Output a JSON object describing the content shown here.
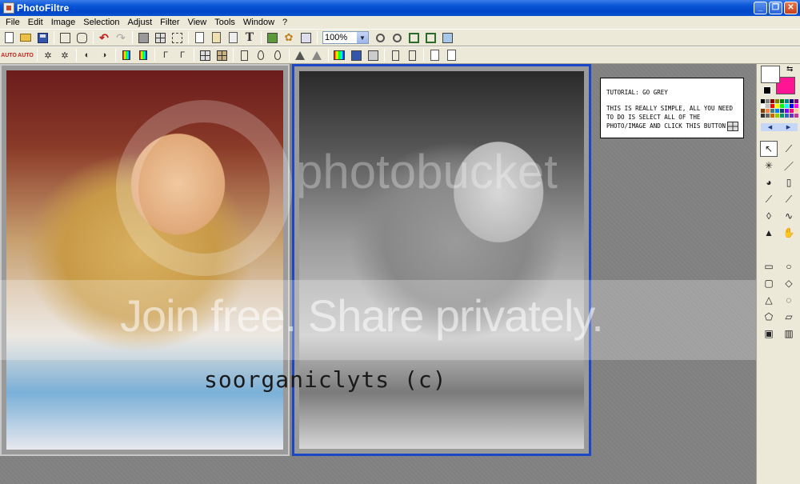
{
  "window": {
    "title": "PhotoFiltre",
    "controls": [
      "minimize",
      "restore",
      "close"
    ]
  },
  "menu": [
    "File",
    "Edit",
    "Image",
    "Selection",
    "Adjust",
    "Filter",
    "View",
    "Tools",
    "Window",
    "?"
  ],
  "toolbar1": {
    "zoom_value": "100%",
    "icons": [
      "new-icon",
      "open-icon",
      "save-icon",
      "print-icon",
      "scan-icon",
      "undo-icon",
      "redo-icon",
      "fill-icon",
      "select-all-icon",
      "crop-icon",
      "copy-icon",
      "paste-icon",
      "paste-new-icon",
      "text-icon",
      "plugin-icon",
      "settings-icon",
      "browser-icon"
    ],
    "zoom_icons": [
      "zoom-in-icon",
      "zoom-out-icon",
      "fit-icon",
      "actual-size-icon",
      "fullscreen-icon"
    ]
  },
  "toolbar2": {
    "auto_label_1": "AUTO",
    "auto_label_2": "AUTO",
    "icons": [
      "auto-levels-icon",
      "auto-contrast-icon",
      "brightness-minus-icon",
      "brightness-plus-icon",
      "contrast-minus-icon",
      "contrast-plus-icon",
      "saturation-minus-icon",
      "saturation-plus-icon",
      "gamma-minus-icon",
      "gamma-plus-icon",
      "grayscale-icon",
      "sepia-icon",
      "flip-icon",
      "blur-icon",
      "sharpen-icon",
      "sharpen-more-icon",
      "smooth-icon",
      "color-icon",
      "swap-icon",
      "frame-icon",
      "rotate-icon",
      "mirror-icon",
      "layer-icon",
      "effect-icon"
    ]
  },
  "note": {
    "heading": "TUTORIAL: GO GREY",
    "body": "THIS IS REALLY SIMPLE, ALL YOU NEED TO DO IS SELECT ALL OF THE PHOTO/IMAGE AND CLICK THIS BUTTON"
  },
  "watermark": {
    "text": "Join free. Share privately.",
    "brand": "photobucket"
  },
  "signature": "soorganiclyts (c)",
  "palette": {
    "foreground": "#ffffff",
    "background": "#ff1493",
    "swatches": [
      "#000000",
      "#808080",
      "#800000",
      "#808000",
      "#008000",
      "#008080",
      "#000080",
      "#800080",
      "#ffffff",
      "#c0c0c0",
      "#ff0000",
      "#ffff00",
      "#00ff00",
      "#00ffff",
      "#0000ff",
      "#ff00ff",
      "#804000",
      "#ff8040",
      "#408080",
      "#0080ff",
      "#004080",
      "#8000ff",
      "#ff0080",
      "#ffcc99",
      "#333333",
      "#666666",
      "#cc6600",
      "#99cc00",
      "#009966",
      "#3366cc",
      "#6633cc",
      "#cc3399"
    ]
  },
  "tools": [
    "selection-arrow-icon",
    "eyedropper-icon",
    "magic-wand-icon",
    "line-icon",
    "fill-bucket-icon",
    "spray-icon",
    "brush-icon",
    "advanced-brush-icon",
    "blur-drop-icon",
    "smudge-icon",
    "stamp-icon",
    "hand-icon",
    "rectangle-icon",
    "ellipse-icon",
    "rounded-rect-icon",
    "diamond-icon",
    "triangle-icon",
    "lasso-icon",
    "polygon-icon",
    "open-folder-icon",
    "frame-small-icon",
    "frame-text-icon"
  ]
}
